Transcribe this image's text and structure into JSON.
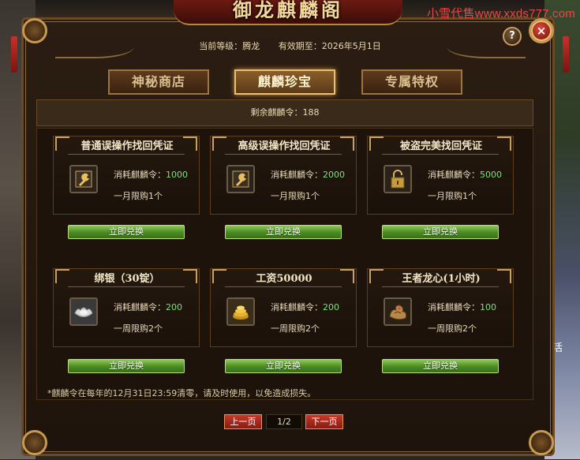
{
  "title": "御龙麒麟阁",
  "watermark": "小雪代售www.xxds777.com",
  "background_text": "活",
  "header": {
    "level_label": "当前等级：腾龙",
    "expiry_label": "有效期至：2026年5月1日"
  },
  "buttons": {
    "help": "?",
    "close": "×"
  },
  "tabs": [
    {
      "label": "神秘商店",
      "active": false
    },
    {
      "label": "麒麟珍宝",
      "active": true
    },
    {
      "label": "专属特权",
      "active": false
    }
  ],
  "remaining": "剩余麒麟令：188",
  "cost_label": "消耗麒麟令：",
  "exchange_label": "立即兑换",
  "items": [
    {
      "name": "普通误操作找回凭证",
      "cost": "1000",
      "limit": "一月限购1个",
      "icon": "wrench-icon"
    },
    {
      "name": "高级误操作找回凭证",
      "cost": "2000",
      "limit": "一月限购1个",
      "icon": "wrench-icon"
    },
    {
      "name": "被盗完美找回凭证",
      "cost": "5000",
      "limit": "一月限购1个",
      "icon": "lock-icon"
    },
    {
      "name": "绑银（30锭）",
      "cost": "200",
      "limit": "一周限购2个",
      "icon": "silver-ingot-icon"
    },
    {
      "name": "工资50000",
      "cost": "200",
      "limit": "一周限购2个",
      "icon": "gold-coins-icon"
    },
    {
      "name": "王者龙心(1小时)",
      "cost": "100",
      "limit": "一周限购2个",
      "icon": "dragon-heart-icon"
    }
  ],
  "notice": "*麒麟令在每年的12月31日23:59清零，请及时使用，以免造成损失。",
  "pagination": {
    "prev": "上一页",
    "next": "下一页",
    "page": "1/2"
  },
  "colors": {
    "accent_green": "#7ee07a",
    "button_green": "#4a8a22",
    "close_red": "#d84a3a",
    "watermark_red": "#e24a4a"
  }
}
